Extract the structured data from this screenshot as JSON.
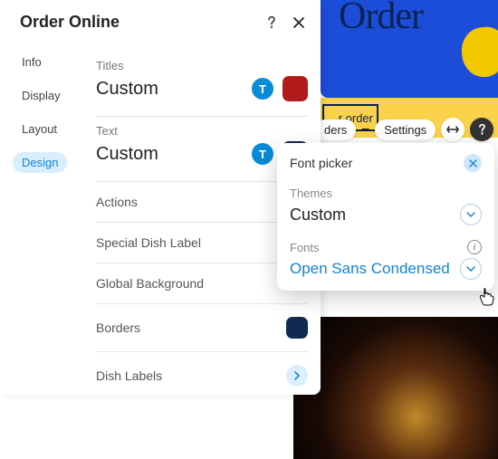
{
  "header": {
    "title": "Order Online"
  },
  "tabs": [
    "Info",
    "Display",
    "Layout",
    "Design"
  ],
  "active_tab": "Design",
  "sections": {
    "titles": {
      "label": "Titles",
      "value": "Custom",
      "swatch": "#b21b1b"
    },
    "text": {
      "label": "Text",
      "value": "Custom",
      "swatch": "#102a52"
    },
    "actions": {
      "label": "Actions"
    },
    "special_dish": {
      "label": "Special Dish Label"
    },
    "global_bg": {
      "label": "Global Background"
    },
    "borders": {
      "label": "Borders",
      "swatch": "#102a52"
    },
    "dish_labels": {
      "label": "Dish Labels"
    }
  },
  "font_picker": {
    "title": "Font picker",
    "themes_label": "Themes",
    "themes_value": "Custom",
    "fonts_label": "Fonts",
    "fonts_value": "Open Sans Condensed"
  },
  "background": {
    "title": "Order",
    "order_btn": "r order",
    "pills": [
      "ders",
      "Settings"
    ]
  },
  "glyphs": {
    "t": "T"
  }
}
